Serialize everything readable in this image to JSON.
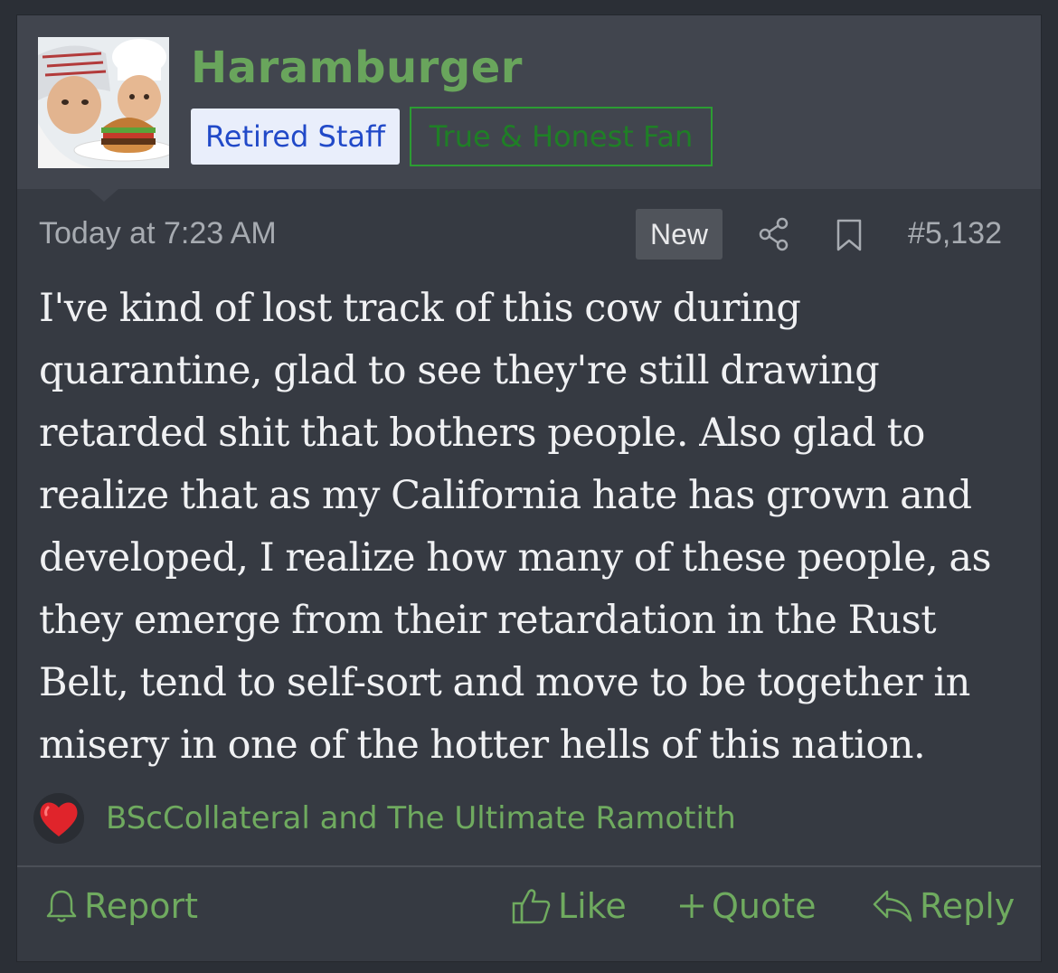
{
  "user": {
    "name": "Haramburger",
    "badges": [
      {
        "label": "Retired Staff",
        "style": "staff"
      },
      {
        "label": "True & Honest Fan",
        "style": "outline-green"
      }
    ]
  },
  "post": {
    "timestamp": "Today at 7:23 AM",
    "new_label": "New",
    "number": "#5,132",
    "body": "I've kind of lost track of this cow during quarantine, glad to see they're still drawing retarded shit that bothers people. Also glad to realize that as my California hate has grown and developed, I realize how many of these people, as they emerge from their retardation in the Rust Belt, tend to self-sort and move to be together in misery in one of the hotter hells of this nation."
  },
  "reactions": {
    "icon": "heart-icon",
    "users_text": "BScCollateral and The Ultimate Ramotith"
  },
  "actions": {
    "report": "Report",
    "like": "Like",
    "quote": "Quote",
    "reply": "Reply"
  },
  "colors": {
    "username": "#69a55c",
    "action": "#6faa5f",
    "card_bg": "#363a42",
    "header_bg": "#41454e"
  }
}
